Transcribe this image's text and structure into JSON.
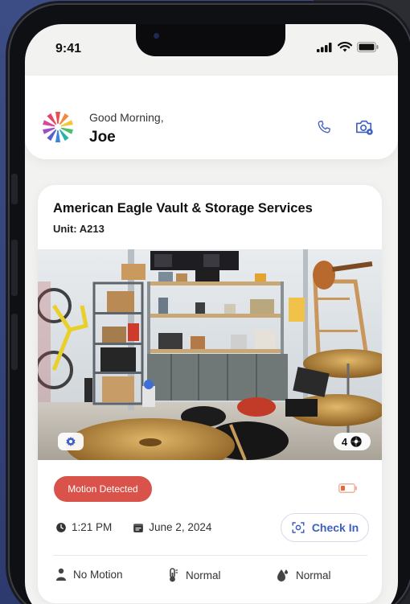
{
  "status_bar": {
    "time": "9:41"
  },
  "header": {
    "greeting": "Good Morning,",
    "name": "Joe",
    "icons": [
      "logo-icon",
      "phone-icon",
      "camera-settings-icon"
    ]
  },
  "card": {
    "facility_name": "American Eagle Vault & Storage Services",
    "unit": "Unit: A213",
    "camera_count": "4",
    "alert": "Motion Detected",
    "time": "1:21 PM",
    "date": "June 2, 2024",
    "checkin_label": "Check In",
    "sensors": [
      {
        "icon": "person-icon",
        "label": "No Motion"
      },
      {
        "icon": "thermometer-icon",
        "label": "Normal"
      },
      {
        "icon": "humidity-icon",
        "label": "Normal"
      }
    ]
  },
  "colors": {
    "alert": "#d9534a",
    "accent": "#3d5fc4",
    "battery_low": "#e8663c"
  }
}
